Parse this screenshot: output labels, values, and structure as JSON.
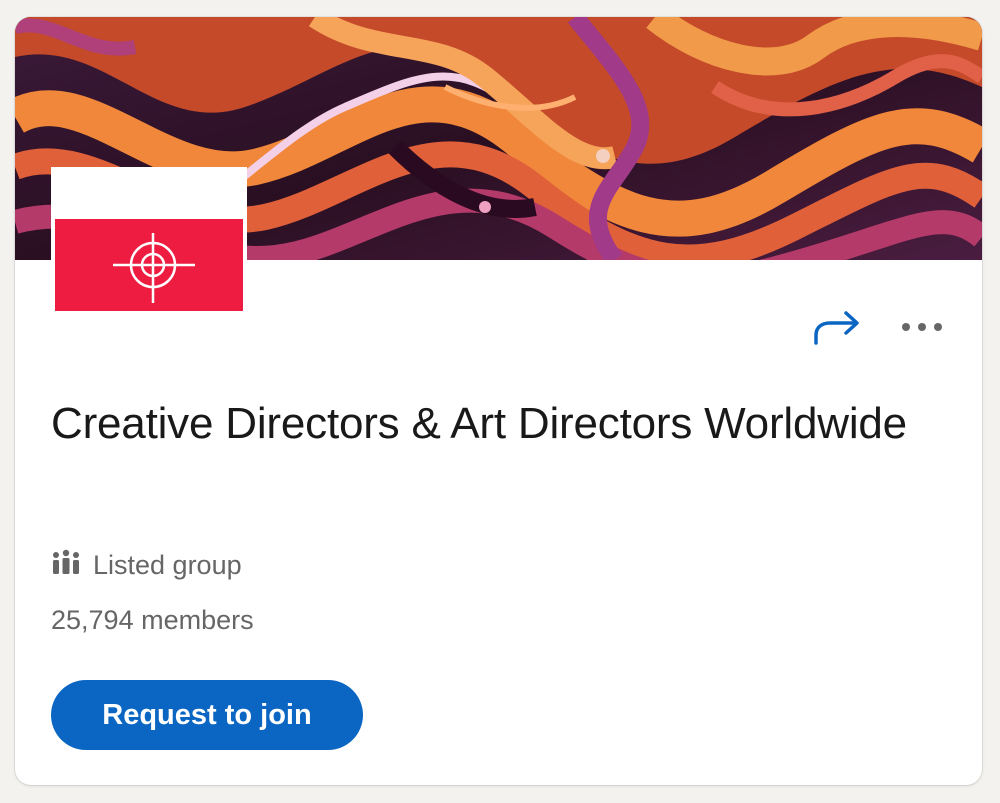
{
  "group": {
    "name": "Creative Directors & Art Directors Worldwide",
    "visibility": "Listed group",
    "members": "25,794 members"
  },
  "actions": {
    "share_icon": "share-arrow-icon",
    "more_icon": "more-options-icon",
    "join_label": "Request to join"
  },
  "colors": {
    "primary": "#0a66c2",
    "logo_red": "#ee1c40",
    "title_text": "#191919",
    "meta_text": "#666666"
  }
}
